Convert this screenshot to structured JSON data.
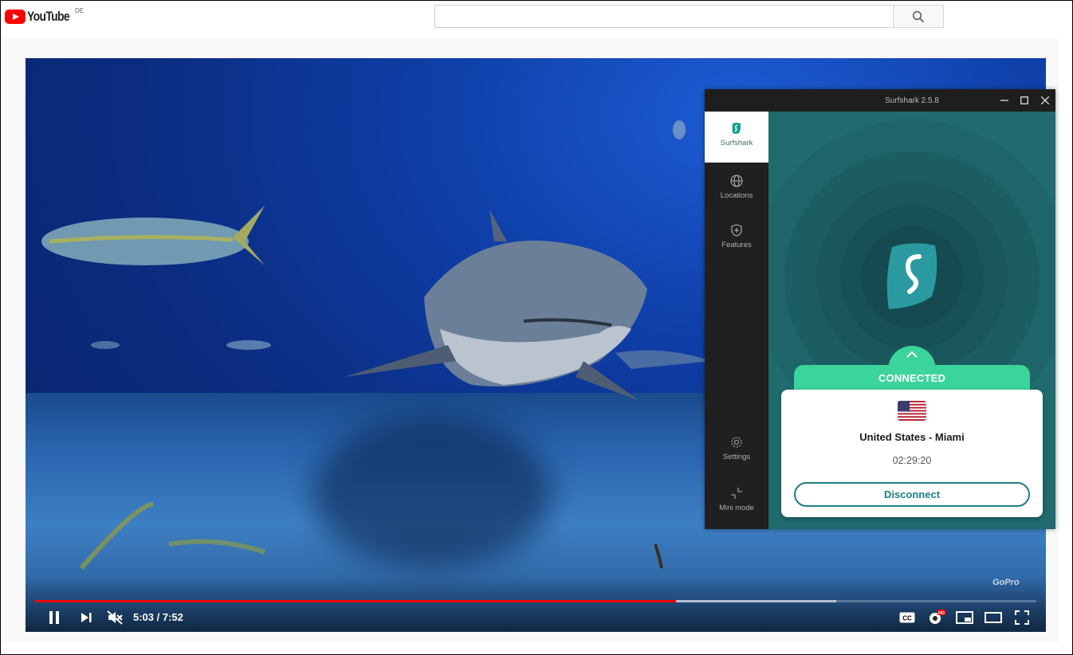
{
  "youtube": {
    "logo_text": "YouTube",
    "region": "DE",
    "search_placeholder": "",
    "search_icon": "search-icon"
  },
  "player": {
    "current_time": "5:03",
    "separator": " / ",
    "duration": "7:52",
    "progress_fraction": 0.64,
    "buffer_fraction": 0.8,
    "watermark": "GoPro",
    "progress_color": "#ff0000"
  },
  "surfshark": {
    "title": "Surfshark 2.5.8",
    "nav": [
      {
        "label": "Surfshark",
        "icon": "surfshark-logo-icon"
      },
      {
        "label": "Locations",
        "icon": "globe-icon"
      },
      {
        "label": "Features",
        "icon": "shield-plus-icon"
      },
      {
        "label": "Settings",
        "icon": "gear-icon"
      },
      {
        "label": "Mini mode",
        "icon": "minimize-icon"
      }
    ],
    "status": "CONNECTED",
    "location": "United States - Miami",
    "timer": "02:29:20",
    "disconnect_label": "Disconnect",
    "accent": "#3bd49a",
    "teal": "#1b7f85"
  }
}
